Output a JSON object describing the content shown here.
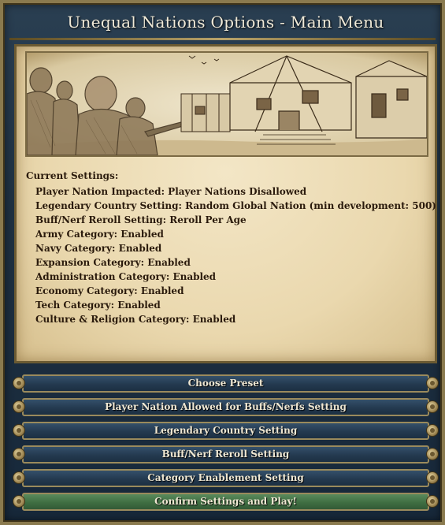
{
  "window": {
    "title": "Unequal Nations Options - Main Menu"
  },
  "settings": {
    "heading": "Current Settings:",
    "items": [
      "Player Nation Impacted: Player Nations Disallowed",
      "Legendary Country Setting: Random Global Nation (min development: 500)",
      "Buff/Nerf Reroll Setting: Reroll Per Age",
      "Army Category: Enabled",
      "Navy Category: Enabled",
      "Expansion Category: Enabled",
      "Administration Category: Enabled",
      "Economy Category: Enabled",
      "Tech Category: Enabled",
      "Culture & Religion Category: Enabled"
    ]
  },
  "buttons": [
    {
      "label": "Choose Preset"
    },
    {
      "label": "Player Nation Allowed for Buffs/Nerfs Setting"
    },
    {
      "label": "Legendary Country Setting"
    },
    {
      "label": "Buff/Nerf Reroll Setting"
    },
    {
      "label": "Category Enablement Setting"
    },
    {
      "label": "Confirm Settings and Play!"
    }
  ],
  "colors": {
    "parchment": "#ead8ae",
    "button_blue": "#243a50",
    "button_green": "#3f6e42",
    "frame_gold": "#9a8a5c"
  }
}
